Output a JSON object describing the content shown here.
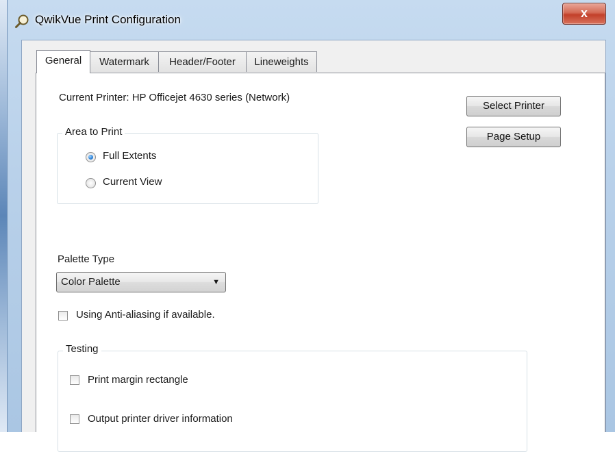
{
  "window": {
    "title": "QwikVue Print Configuration",
    "close_label": "x"
  },
  "tabs": [
    {
      "label": "General",
      "active": true
    },
    {
      "label": "Watermark",
      "active": false
    },
    {
      "label": "Header/Footer",
      "active": false
    },
    {
      "label": "Lineweights",
      "active": false
    }
  ],
  "general": {
    "current_printer": "Current Printer:  HP Officejet 4630 series (Network)",
    "select_printer_label": "Select Printer",
    "page_setup_label": "Page Setup",
    "area_to_print": {
      "legend": "Area to Print",
      "options": [
        {
          "label": "Full Extents",
          "checked": true
        },
        {
          "label": "Current View",
          "checked": false
        }
      ]
    },
    "palette_type": {
      "label": "Palette Type",
      "selected": "Color Palette"
    },
    "anti_aliasing": {
      "label": "Using Anti-aliasing if available.",
      "checked": false
    },
    "testing": {
      "legend": "Testing",
      "options": [
        {
          "label": "Print margin rectangle",
          "checked": false
        },
        {
          "label": "Output printer driver information",
          "checked": false
        }
      ]
    }
  }
}
